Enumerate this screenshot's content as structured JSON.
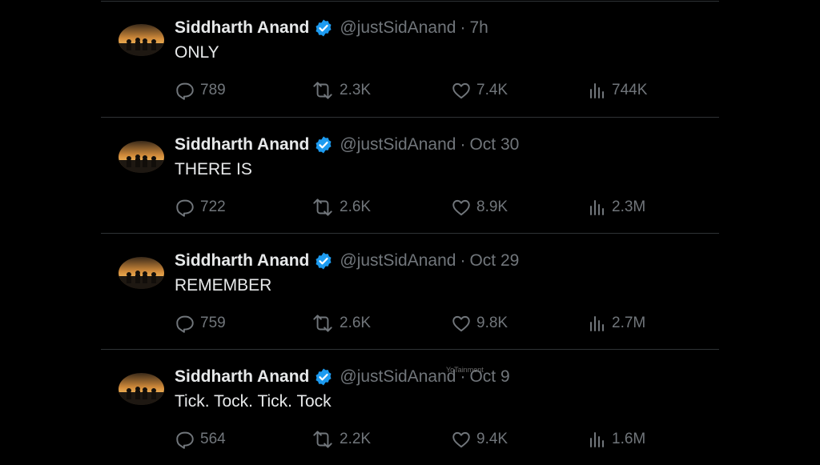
{
  "colors": {
    "background": "#000000",
    "name": "#e7e9ea",
    "muted": "#71767b",
    "verified": "#1d9bf0",
    "divider": "#2f3336"
  },
  "tweets": [
    {
      "name": "Siddharth Anand",
      "handle": "@justSidAnand",
      "separator": "·",
      "time": "7h",
      "text": "ONLY",
      "replies": "789",
      "retweets": "2.3K",
      "likes": "7.4K",
      "views": "744K"
    },
    {
      "name": "Siddharth Anand",
      "handle": "@justSidAnand",
      "separator": "·",
      "time": "Oct 30",
      "text": "THERE IS",
      "replies": "722",
      "retweets": "2.6K",
      "likes": "8.9K",
      "views": "2.3M"
    },
    {
      "name": "Siddharth Anand",
      "handle": "@justSidAnand",
      "separator": "·",
      "time": "Oct 29",
      "text": "REMEMBER",
      "replies": "759",
      "retweets": "2.6K",
      "likes": "9.8K",
      "views": "2.7M"
    },
    {
      "name": "Siddharth Anand",
      "handle": "@justSidAnand",
      "separator": "·",
      "time": "Oct 9",
      "text": "Tick. Tock. Tick. Tock",
      "replies": "564",
      "retweets": "2.2K",
      "likes": "9.4K",
      "views": "1.6M"
    }
  ],
  "watermark": "YoTainment",
  "icons": {
    "reply": "reply-icon",
    "retweet": "retweet-icon",
    "like": "heart-icon",
    "views": "views-icon",
    "verified": "verified-badge-icon"
  }
}
